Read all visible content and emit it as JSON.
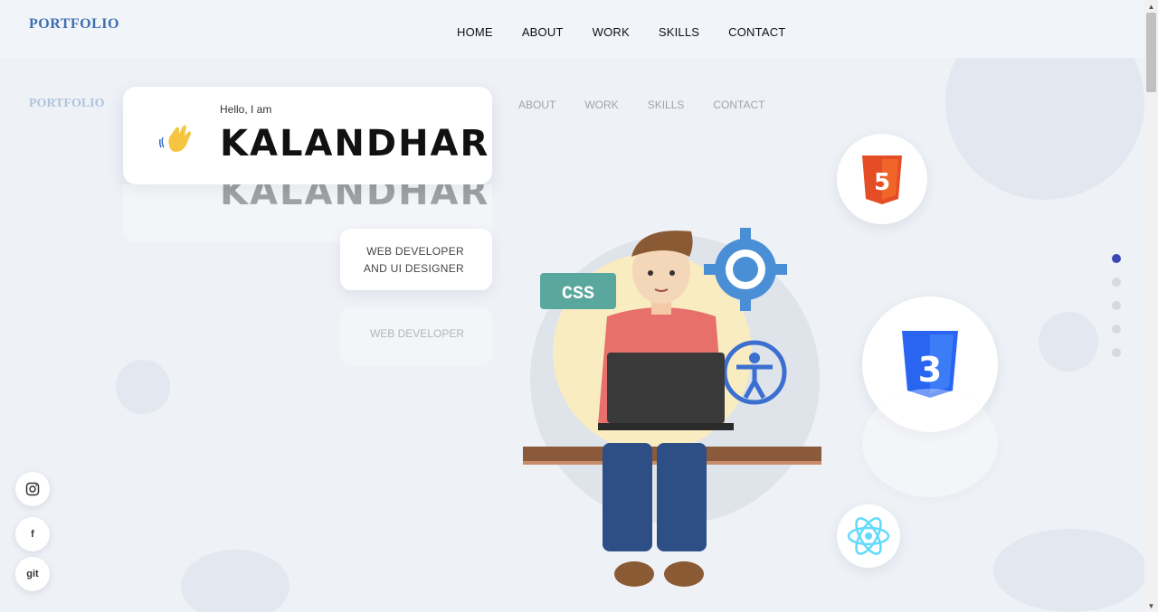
{
  "header": {
    "logo_text": "PORTFOLIO",
    "nav": [
      "HOME",
      "ABOUT",
      "WORK",
      "SKILLS",
      "CONTACT"
    ]
  },
  "hero": {
    "greeting": "Hello, I am",
    "name": "KALANDHAR",
    "role_line1": "WEB DEVELOPER",
    "role_line2": "AND UI DESIGNER",
    "css_badge": "CSS"
  },
  "skills_icons": [
    "html5-icon",
    "css3-icon",
    "react-icon"
  ],
  "socials": {
    "instagram": "instagram-icon",
    "facebook": "f",
    "github": "git"
  },
  "section_dots": {
    "count": 5,
    "active_index": 0
  },
  "colors": {
    "background": "#eef1f6",
    "accent": "#3b47b6",
    "html5": "#e44d26",
    "css3": "#2965f1",
    "react": "#61dafb"
  }
}
